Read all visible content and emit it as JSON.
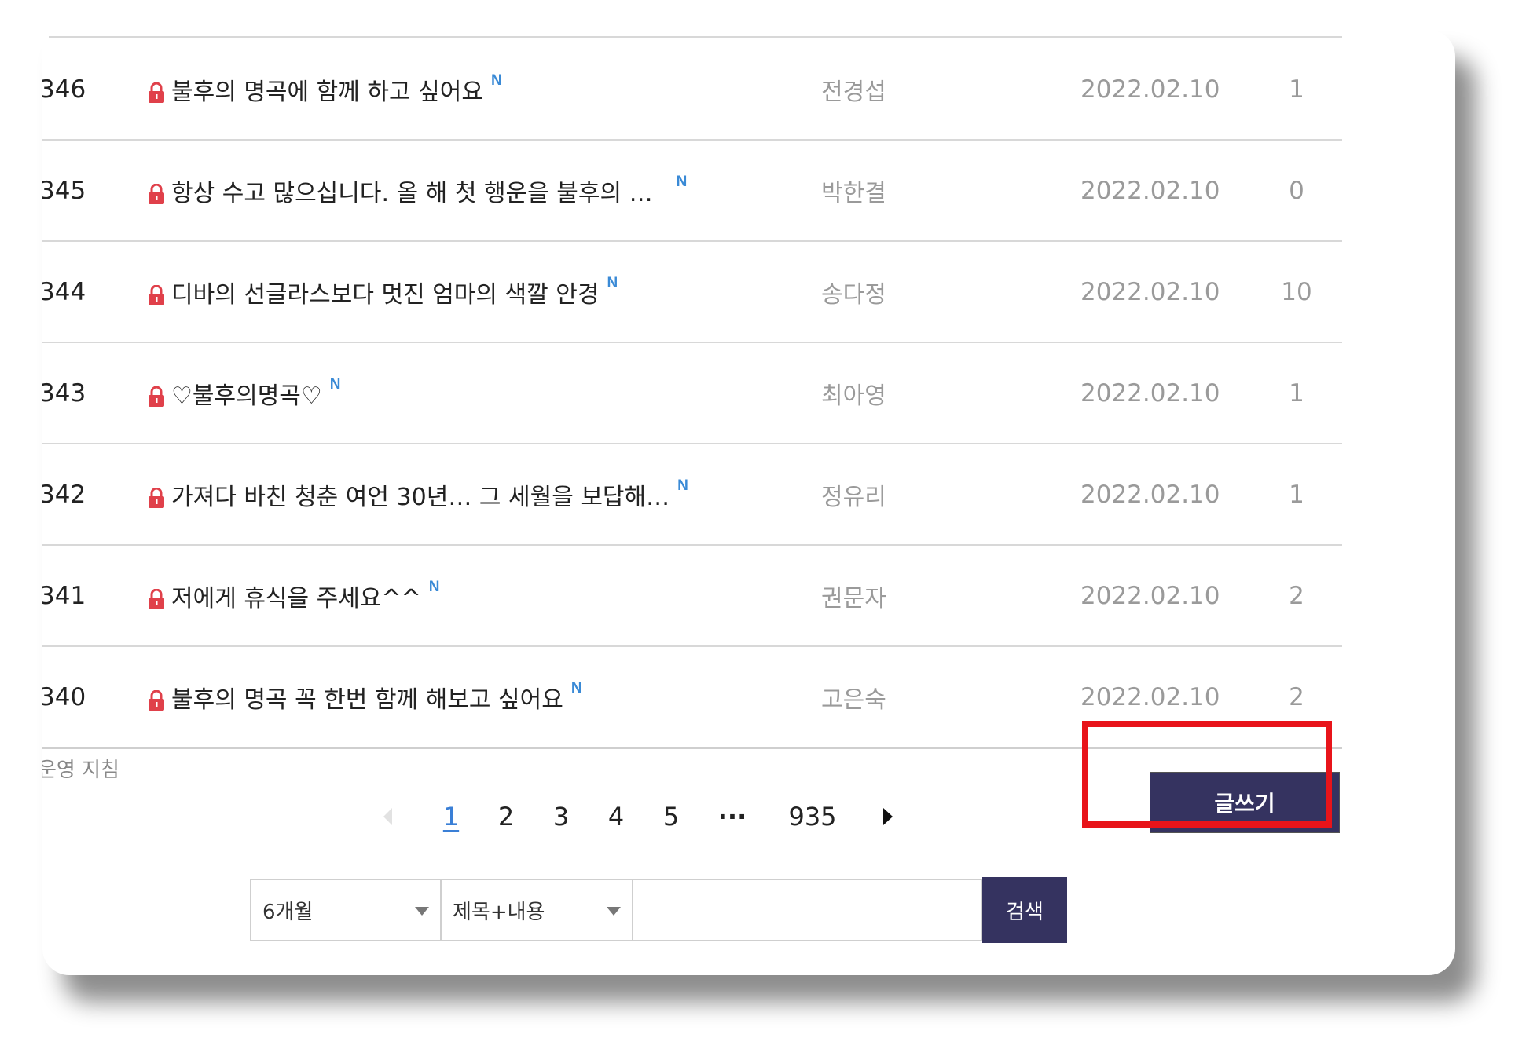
{
  "posts": [
    {
      "num": "346",
      "title": "불후의 명곡에 함께 하고 싶어요",
      "author": "전경섭",
      "date": "2022.02.10",
      "views": "1",
      "badge": "N"
    },
    {
      "num": "345",
      "title": "항상 수고 많으십니다. 올 해 첫 행운을 불후의 …",
      "author": "박한결",
      "date": "2022.02.10",
      "views": "0",
      "badge": "N"
    },
    {
      "num": "344",
      "title": "디바의 선글라스보다 멋진 엄마의 색깔 안경",
      "author": "송다정",
      "date": "2022.02.10",
      "views": "10",
      "badge": "N"
    },
    {
      "num": "343",
      "title": "♡불후의명곡♡",
      "author": "최아영",
      "date": "2022.02.10",
      "views": "1",
      "badge": "N"
    },
    {
      "num": "342",
      "title": "가져다 바친 청춘 여언 30년… 그 세월을 보답해…",
      "author": "정유리",
      "date": "2022.02.10",
      "views": "1",
      "badge": "N"
    },
    {
      "num": "341",
      "title": "저에게 휴식을 주세요^^",
      "author": "권문자",
      "date": "2022.02.10",
      "views": "2",
      "badge": "N"
    },
    {
      "num": "340",
      "title": "불후의 명곡 꼭 한번 함께 해보고 싶어요",
      "author": "고은숙",
      "date": "2022.02.10",
      "views": "2",
      "badge": "N"
    }
  ],
  "footer": {
    "rules_link": "운영 지침",
    "write_label": "글쓰기"
  },
  "pagination": {
    "pages": [
      "1",
      "2",
      "3",
      "4",
      "5"
    ],
    "ellipsis": "···",
    "last": "935",
    "current": "1"
  },
  "search": {
    "period_value": "6개월",
    "scope_value": "제목+내용",
    "query_value": "",
    "button_label": "검색"
  },
  "colors": {
    "accent": "#353360",
    "new_badge": "#3a8ad6",
    "lock": "#e0404a",
    "highlight": "#e8141a"
  },
  "icons": {
    "lock": "lock-icon",
    "prev": "prev-arrow-icon",
    "next": "next-arrow-icon",
    "caret": "chevron-down-icon"
  }
}
